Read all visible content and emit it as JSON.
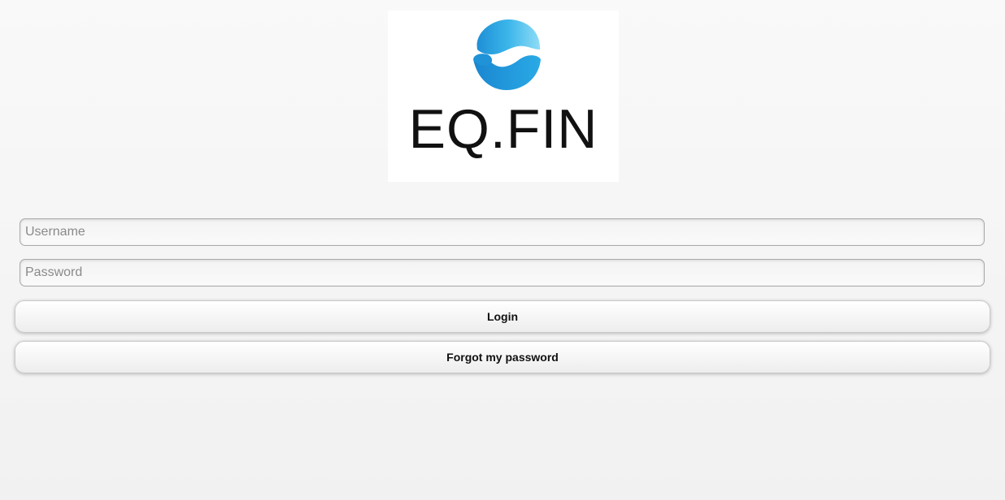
{
  "logo": {
    "wordmark": "EQ.FIN",
    "icon": "eqfin-wave-logo-icon"
  },
  "form": {
    "username_placeholder": "Username",
    "password_placeholder": "Password",
    "username_value": "",
    "password_value": ""
  },
  "buttons": {
    "login_label": "Login",
    "forgot_label": "Forgot my password"
  },
  "colors": {
    "logo_light_blue": "#3cc3ee",
    "logo_dark_blue": "#1e8fd6",
    "logo_text": "#111111",
    "background": "#f4f4f4"
  }
}
